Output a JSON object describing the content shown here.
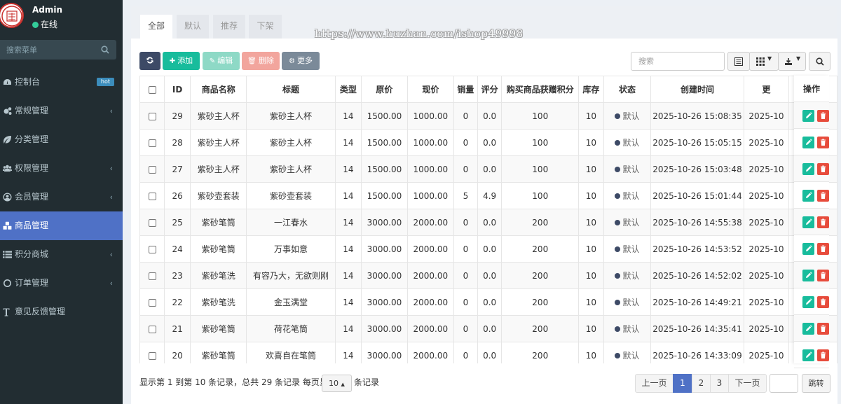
{
  "user": {
    "name": "Admin",
    "status": "在线"
  },
  "sidebar": {
    "search_placeholder": "搜索菜单",
    "items": [
      {
        "label": "控制台",
        "icon": "dashboard-icon",
        "badge": "hot",
        "chevron": ""
      },
      {
        "label": "常规管理",
        "icon": "cogs-icon",
        "badge": "",
        "chevron": "‹"
      },
      {
        "label": "分类管理",
        "icon": "leaf-icon",
        "badge": "",
        "chevron": ""
      },
      {
        "label": "权限管理",
        "icon": "group-icon",
        "badge": "",
        "chevron": "‹"
      },
      {
        "label": "会员管理",
        "icon": "user-circle-icon",
        "badge": "",
        "chevron": "‹"
      },
      {
        "label": "商品管理",
        "icon": "cubes-icon",
        "badge": "",
        "chevron": "",
        "active": true
      },
      {
        "label": "积分商城",
        "icon": "list-icon",
        "badge": "",
        "chevron": "‹"
      },
      {
        "label": "订单管理",
        "icon": "circle-o-icon",
        "badge": "",
        "chevron": "‹"
      },
      {
        "label": "意见反馈管理",
        "icon": "text-height-icon",
        "badge": "",
        "chevron": ""
      }
    ]
  },
  "tabs": [
    "全部",
    "默认",
    "推荐",
    "下架"
  ],
  "watermark": "https://www.huzhan.com/ishop49998",
  "toolbar": {
    "refresh_icon": "refresh-icon",
    "add": "添加",
    "edit": "编辑",
    "delete": "删除",
    "more": "更多",
    "search_placeholder": "搜索",
    "colors": {
      "refresh": "#3d4a66",
      "add": "#18bc9c",
      "edit": "#18bc9c",
      "delete": "#e74c3c",
      "more": "#7b8a99"
    }
  },
  "table": {
    "headers": [
      "ID",
      "商品名称",
      "标题",
      "类型",
      "原价",
      "现价",
      "销量",
      "评分",
      "购买商品获赠积分",
      "库存",
      "状态",
      "创建时间",
      "更",
      "操作"
    ],
    "rows": [
      {
        "id": "29",
        "name": "紫砂主人杯",
        "title": "紫砂主人杯",
        "type": "14",
        "orig": "1500.00",
        "price": "1000.00",
        "sales": "0",
        "score": "0.0",
        "points": "100",
        "stock": "10",
        "status": "默认",
        "created": "2025-10-26 15:08:35",
        "updated": "2025-10"
      },
      {
        "id": "28",
        "name": "紫砂主人杯",
        "title": "紫砂主人杯",
        "type": "14",
        "orig": "1500.00",
        "price": "1000.00",
        "sales": "0",
        "score": "0.0",
        "points": "100",
        "stock": "10",
        "status": "默认",
        "created": "2025-10-26 15:05:15",
        "updated": "2025-10"
      },
      {
        "id": "27",
        "name": "紫砂主人杯",
        "title": "紫砂主人杯",
        "type": "14",
        "orig": "1500.00",
        "price": "1000.00",
        "sales": "0",
        "score": "0.0",
        "points": "100",
        "stock": "10",
        "status": "默认",
        "created": "2025-10-26 15:03:48",
        "updated": "2025-10"
      },
      {
        "id": "26",
        "name": "紫砂壶套装",
        "title": "紫砂壶套装",
        "type": "14",
        "orig": "1500.00",
        "price": "1000.00",
        "sales": "5",
        "score": "4.9",
        "points": "100",
        "stock": "10",
        "status": "默认",
        "created": "2025-10-26 15:01:44",
        "updated": "2025-10"
      },
      {
        "id": "25",
        "name": "紫砂笔筒",
        "title": "一江春水",
        "type": "14",
        "orig": "3000.00",
        "price": "2000.00",
        "sales": "0",
        "score": "0.0",
        "points": "200",
        "stock": "10",
        "status": "默认",
        "created": "2025-10-26 14:55:38",
        "updated": "2025-10"
      },
      {
        "id": "24",
        "name": "紫砂笔筒",
        "title": "万事如意",
        "type": "14",
        "orig": "3000.00",
        "price": "2000.00",
        "sales": "0",
        "score": "0.0",
        "points": "200",
        "stock": "10",
        "status": "默认",
        "created": "2025-10-26 14:53:52",
        "updated": "2025-10"
      },
      {
        "id": "23",
        "name": "紫砂笔洗",
        "title": "有容乃大，无欲则刚",
        "type": "14",
        "orig": "3000.00",
        "price": "2000.00",
        "sales": "0",
        "score": "0.0",
        "points": "200",
        "stock": "10",
        "status": "默认",
        "created": "2025-10-26 14:52:02",
        "updated": "2025-10"
      },
      {
        "id": "22",
        "name": "紫砂笔洗",
        "title": "金玉满堂",
        "type": "14",
        "orig": "3000.00",
        "price": "2000.00",
        "sales": "0",
        "score": "0.0",
        "points": "200",
        "stock": "10",
        "status": "默认",
        "created": "2025-10-26 14:49:21",
        "updated": "2025-10"
      },
      {
        "id": "21",
        "name": "紫砂笔筒",
        "title": "荷花笔筒",
        "type": "14",
        "orig": "3000.00",
        "price": "2000.00",
        "sales": "0",
        "score": "0.0",
        "points": "200",
        "stock": "10",
        "status": "默认",
        "created": "2025-10-26 14:35:41",
        "updated": "2025-10"
      },
      {
        "id": "20",
        "name": "紫砂笔筒",
        "title": "欢喜自在笔筒",
        "type": "14",
        "orig": "3000.00",
        "price": "2000.00",
        "sales": "0",
        "score": "0.0",
        "points": "200",
        "stock": "10",
        "status": "默认",
        "created": "2025-10-26 14:33:09",
        "updated": "2025-10"
      }
    ]
  },
  "footer": {
    "summary": "显示第 1 到第 10 条记录，总共 29 条记录 每页显示",
    "page_size": "10",
    "after": "条记录"
  },
  "pagination": {
    "prev": "上一页",
    "pages": [
      "1",
      "2",
      "3"
    ],
    "current": "1",
    "next": "下一页",
    "go": "跳转"
  },
  "colors": {
    "sidebar_bg": "#222d32",
    "active": "#4f71c6",
    "status_dot": "#3d4a66"
  }
}
